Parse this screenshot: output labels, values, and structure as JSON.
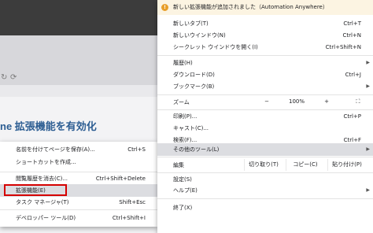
{
  "background": {
    "page_title_partial": "ne 拡張機能を有効化"
  },
  "submenu": {
    "items": [
      {
        "label": "名前を付けてページを保存(A)...",
        "shortcut": "Ctrl+S"
      },
      {
        "label": "ショートカットを作成...",
        "shortcut": ""
      },
      {
        "label": "閲覧履歴を消去(C)...",
        "shortcut": "Ctrl+Shift+Delete"
      },
      {
        "label": "拡張機能(E)",
        "shortcut": ""
      },
      {
        "label": "タスク マネージャ(T)",
        "shortcut": "Shift+Esc"
      },
      {
        "label": "デベロッパー ツール(D)",
        "shortcut": "Ctrl+Shift+I"
      }
    ]
  },
  "menu": {
    "notification": "新しい拡張機能が追加されました（Automation Anywhere）",
    "new_tab": {
      "label": "新しいタブ(T)",
      "shortcut": "Ctrl+T"
    },
    "new_window": {
      "label": "新しいウインドウ(N)",
      "shortcut": "Ctrl+N"
    },
    "incognito": {
      "label": "シークレット ウインドウを開く(I)",
      "shortcut": "Ctrl+Shift+N"
    },
    "history": {
      "label": "履歴(H)"
    },
    "downloads": {
      "label": "ダウンロード(D)",
      "shortcut": "Ctrl+J"
    },
    "bookmarks": {
      "label": "ブックマーク(B)"
    },
    "zoom": {
      "label": "ズーム",
      "minus": "−",
      "value": "100%",
      "plus": "+",
      "fullscreen": "⛶"
    },
    "print": {
      "label": "印刷(P)...",
      "shortcut": "Ctrl+P"
    },
    "cast": {
      "label": "キャスト(C)..."
    },
    "find": {
      "label": "検索(F)...",
      "shortcut": "Ctrl+F"
    },
    "more_tools": {
      "label": "その他のツール(L)"
    },
    "edit": {
      "label": "編集",
      "cut": "切り取り(T)",
      "copy": "コピー(C)",
      "paste": "貼り付け(P)"
    },
    "settings": {
      "label": "設定(S)"
    },
    "help": {
      "label": "ヘルプ(E)"
    },
    "exit": {
      "label": "終了(X)"
    }
  },
  "colors": {
    "notification_bg": "#fcf4e2",
    "hover_bg": "#dcdde1",
    "highlight_border": "#d50000",
    "brand_blue": "#2c5d92"
  }
}
